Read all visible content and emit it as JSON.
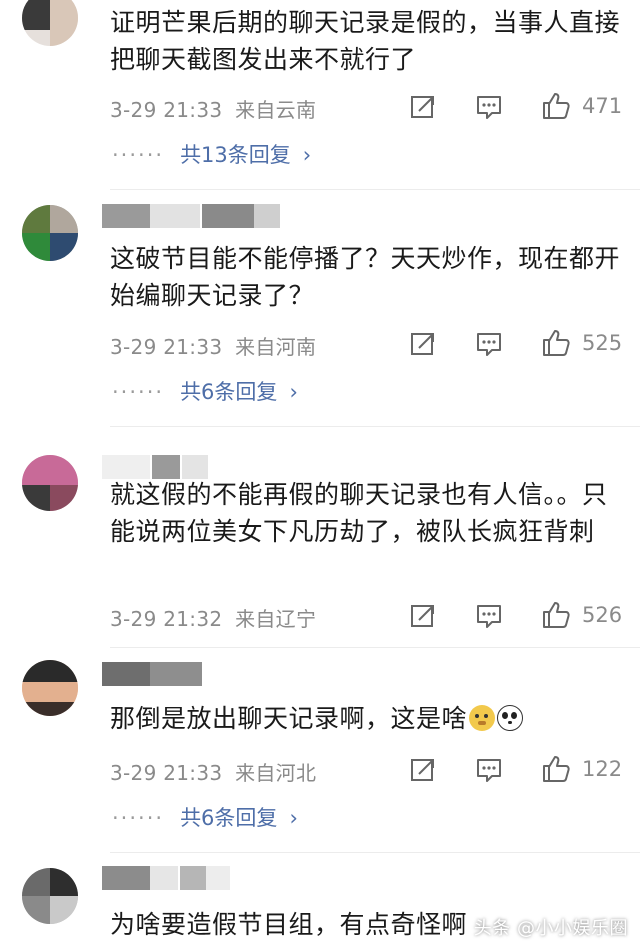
{
  "comments": [
    {
      "text": "证明芒果后期的聊天记录是假的，当事人直接把聊天截图发出来不就行了",
      "time": "3-29 21:33",
      "location": "来自云南",
      "likes": "471",
      "replies": "共13条回复",
      "dots": "······",
      "chevron": "›"
    },
    {
      "text": "这破节目能不能停播了？天天炒作，现在都开始编聊天记录了？",
      "time": "3-29 21:33",
      "location": "来自河南",
      "likes": "525",
      "replies": "共6条回复",
      "dots": "······",
      "chevron": "›"
    },
    {
      "text": "就这假的不能再假的聊天记录也有人信。。只能说两位美女下凡历劫了，被队长疯狂背刺",
      "time": "3-29 21:32",
      "location": "来自辽宁",
      "likes": "526"
    },
    {
      "text": "那倒是放出聊天记录啊，这是啥",
      "time": "3-29 21:33",
      "location": "来自河北",
      "likes": "122",
      "replies": "共6条回复",
      "dots": "······",
      "chevron": "›"
    },
    {
      "text": "为啥要造假节目组，有点奇怪啊"
    }
  ],
  "watermark": "头条 @小小娱乐圈",
  "colors": {
    "link": "#4e6ea8",
    "meta": "#8a8a8a",
    "text": "#1a1a1a"
  }
}
